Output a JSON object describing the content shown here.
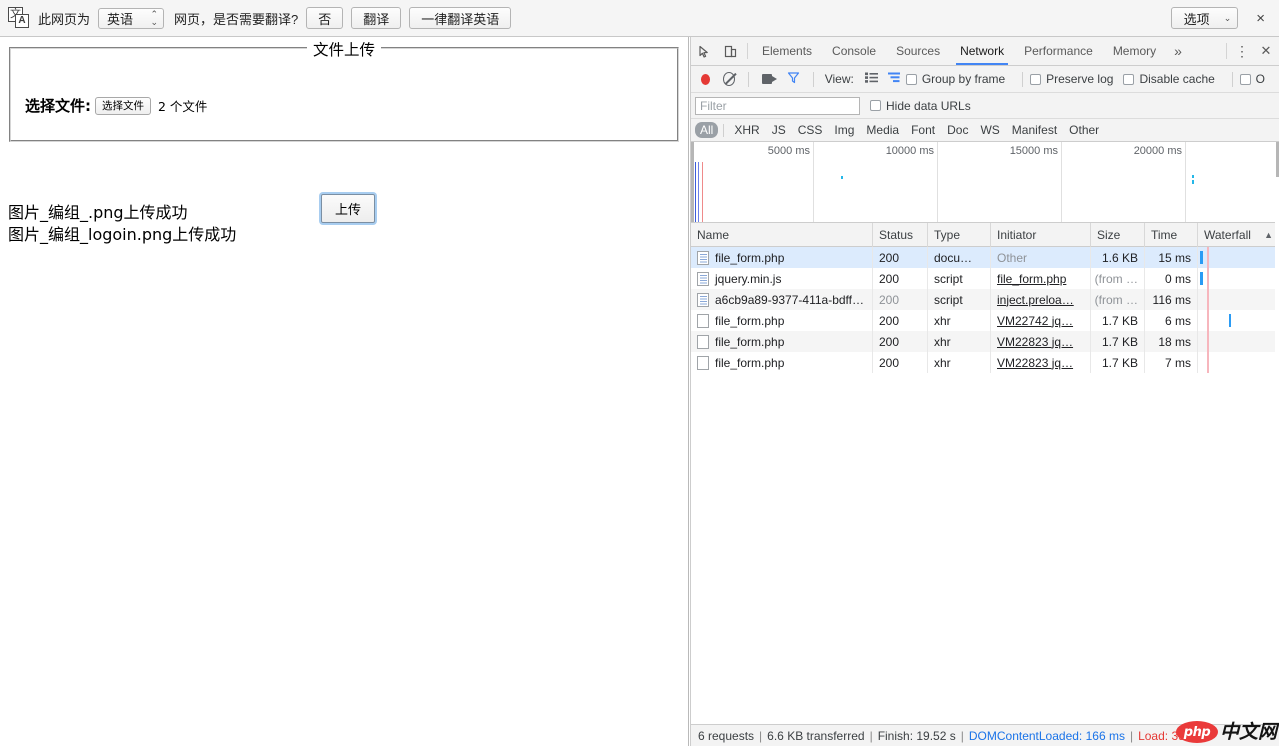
{
  "translate_bar": {
    "icon": "translate-icon",
    "prefix_text": "此网页为",
    "language_value": "英语",
    "question_text": "网页，是否需要翻译?",
    "no_label": "否",
    "translate_label": "翻译",
    "always_label": "一律翻译英语",
    "options_label": "选项",
    "close_label": "×"
  },
  "page": {
    "fieldset_legend": "文件上传",
    "file_label": "选择文件:",
    "choose_file_button": "选择文件",
    "file_count": "2 个文件",
    "upload_button": "上传",
    "messages": [
      "图片_编组_.png上传成功",
      "图片_编组_logoin.png上传成功"
    ]
  },
  "devtools": {
    "tabs": [
      {
        "label": "Elements",
        "active": false
      },
      {
        "label": "Console",
        "active": false
      },
      {
        "label": "Sources",
        "active": false
      },
      {
        "label": "Network",
        "active": true
      },
      {
        "label": "Performance",
        "active": false
      },
      {
        "label": "Memory",
        "active": false
      }
    ],
    "more_tabs_label": "»",
    "menu_label": "⋮",
    "close_label": "✕",
    "toolbar": {
      "record_icon": "record-icon",
      "clear_icon": "clear-icon",
      "camera_icon": "camera-icon",
      "filter_icon": "funnel-icon",
      "view_label": "View:",
      "list_view_icon": "list-view-icon",
      "waterfall_view_icon": "waterfall-view-icon",
      "group_by_frame": "Group by frame",
      "preserve_log": "Preserve log",
      "disable_cache": "Disable cache",
      "offline": "O"
    },
    "filter": {
      "placeholder": "Filter",
      "value": "",
      "hide_data_urls": "Hide data URLs"
    },
    "type_filters": [
      {
        "label": "All",
        "active": true
      },
      {
        "label": "XHR",
        "active": false
      },
      {
        "label": "JS",
        "active": false
      },
      {
        "label": "CSS",
        "active": false
      },
      {
        "label": "Img",
        "active": false
      },
      {
        "label": "Media",
        "active": false
      },
      {
        "label": "Font",
        "active": false
      },
      {
        "label": "Doc",
        "active": false
      },
      {
        "label": "WS",
        "active": false
      },
      {
        "label": "Manifest",
        "active": false
      },
      {
        "label": "Other",
        "active": false
      }
    ],
    "overview_ticks": [
      "5000 ms",
      "10000 ms",
      "15000 ms",
      "20000 ms"
    ],
    "columns": [
      {
        "label": "Name"
      },
      {
        "label": "Status"
      },
      {
        "label": "Type"
      },
      {
        "label": "Initiator"
      },
      {
        "label": "Size"
      },
      {
        "label": "Time"
      },
      {
        "label": "Waterfall"
      }
    ],
    "sort_indicator": "▲",
    "requests": [
      {
        "icon": "document-file-icon",
        "name": "file_form.php",
        "status": "200",
        "type": "docu…",
        "initiator": "Other",
        "initiator_link": false,
        "size": "1.6 KB",
        "time": "15 ms",
        "selected": true
      },
      {
        "icon": "script-file-icon",
        "name": "jquery.min.js",
        "status": "200",
        "type": "script",
        "initiator": "file_form.php",
        "initiator_link": true,
        "size": "(from …",
        "time": "0 ms",
        "selected": false
      },
      {
        "icon": "script-file-icon",
        "name": "a6cb9a89-9377-411a-bdff…",
        "status": "200",
        "type": "script",
        "initiator": "inject.preloa…",
        "initiator_link": true,
        "size": "(from …",
        "time": "116 ms",
        "selected": false
      },
      {
        "icon": "xhr-file-icon",
        "name": "file_form.php",
        "status": "200",
        "type": "xhr",
        "initiator": "VM22742 jq…",
        "initiator_link": true,
        "size": "1.7 KB",
        "time": "6 ms",
        "selected": false
      },
      {
        "icon": "xhr-file-icon",
        "name": "file_form.php",
        "status": "200",
        "type": "xhr",
        "initiator": "VM22823 jq…",
        "initiator_link": true,
        "size": "1.7 KB",
        "time": "18 ms",
        "selected": false
      },
      {
        "icon": "xhr-file-icon",
        "name": "file_form.php",
        "status": "200",
        "type": "xhr",
        "initiator": "VM22823 jq…",
        "initiator_link": true,
        "size": "1.7 KB",
        "time": "7 ms",
        "selected": false
      }
    ],
    "status_bar": {
      "requests": "6 requests",
      "transferred": "6.6 KB transferred",
      "finish": "Finish: 19.52 s",
      "dom_content_loaded": "DOMContentLoaded: 166 ms",
      "load": "Load: 391 ms"
    },
    "watermark": {
      "logo_text": "php",
      "site_text": "中文网"
    }
  },
  "colors": {
    "accent_blue": "#4285f4",
    "record_red": "#e53935",
    "selected_row": "#dcebfd",
    "link_blue": "#1a73e8",
    "php_red": "#ea3a3a"
  }
}
